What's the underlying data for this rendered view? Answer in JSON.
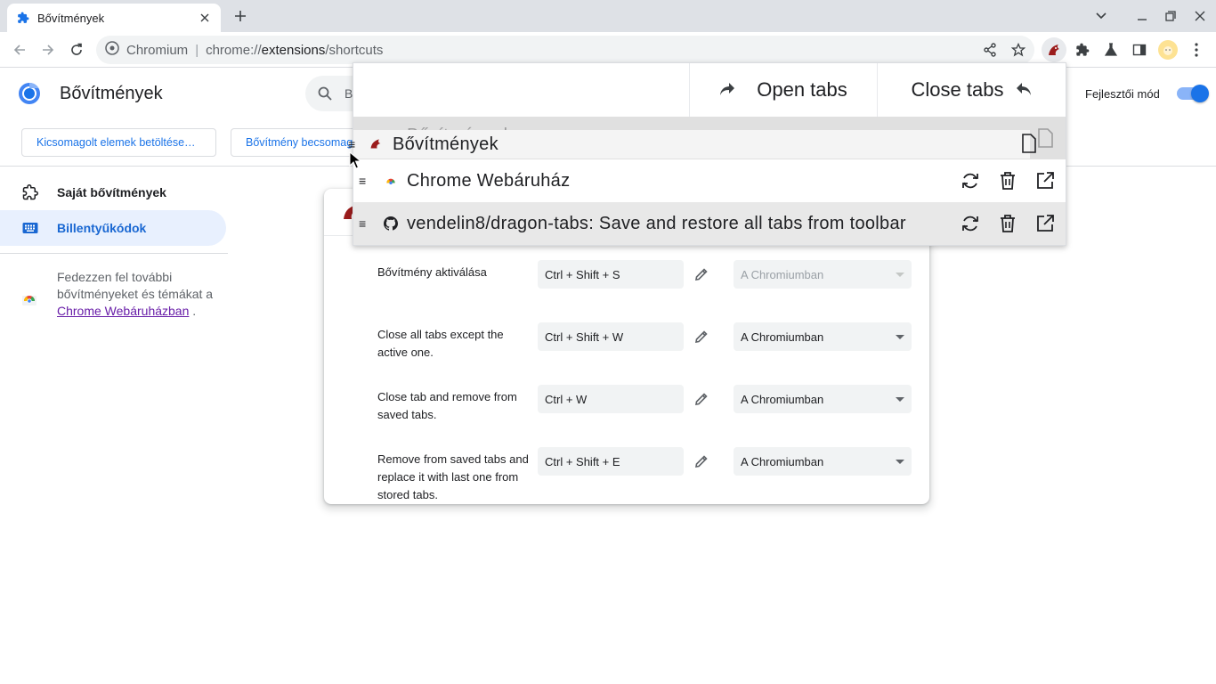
{
  "browser": {
    "tab_title": "Bővítmények",
    "omnibox": {
      "site_label": "Chromium",
      "url_scheme": "chrome://",
      "url_host": "extensions",
      "url_path": "/shortcuts"
    }
  },
  "header": {
    "title": "Bővítmények",
    "search_placeholder": "B",
    "dev_mode_label": "Fejlesztői mód",
    "dev_mode_on": true
  },
  "actions": {
    "load_unpacked": "Kicsomagolt elemek betöltése…",
    "pack_extension": "Bővítmény becsomagolása"
  },
  "sidebar": {
    "items": [
      {
        "label": "Saját bővítmények",
        "icon": "extension-icon",
        "selected": false
      },
      {
        "label": "Billentyűkódok",
        "icon": "keyboard-icon",
        "selected": true
      }
    ],
    "promo_text": "Fedezzen fel további bővítményeket és témákat a",
    "promo_link": "Chrome Webáruházban",
    "promo_suffix": "."
  },
  "shortcuts": [
    {
      "label": "Bővítmény aktiválása",
      "keys": "Ctrl + Shift + S",
      "scope": "A Chromiumban",
      "scope_disabled": true
    },
    {
      "label": "Close all tabs except the active one.",
      "keys": "Ctrl + Shift + W",
      "scope": "A Chromiumban",
      "scope_disabled": false
    },
    {
      "label": "Close tab and remove from saved tabs.",
      "keys": "Ctrl + W",
      "scope": "A Chromiumban",
      "scope_disabled": false
    },
    {
      "label": "Remove from saved tabs and replace it with last one from stored tabs.",
      "keys": "Ctrl + Shift + E",
      "scope": "A Chromiumban",
      "scope_disabled": false
    }
  ],
  "popup": {
    "open_tabs": "Open tabs",
    "close_tabs": "Close tabs",
    "dragging_row": "Bővítmények",
    "ghost_row": "Bővítmények",
    "rows": [
      {
        "title": "Chrome Webáruház",
        "favicon": "chrome-webstore-icon"
      },
      {
        "title": "vendelin8/dragon-tabs: Save and restore all tabs from toolbar",
        "favicon": "github-icon"
      }
    ]
  }
}
